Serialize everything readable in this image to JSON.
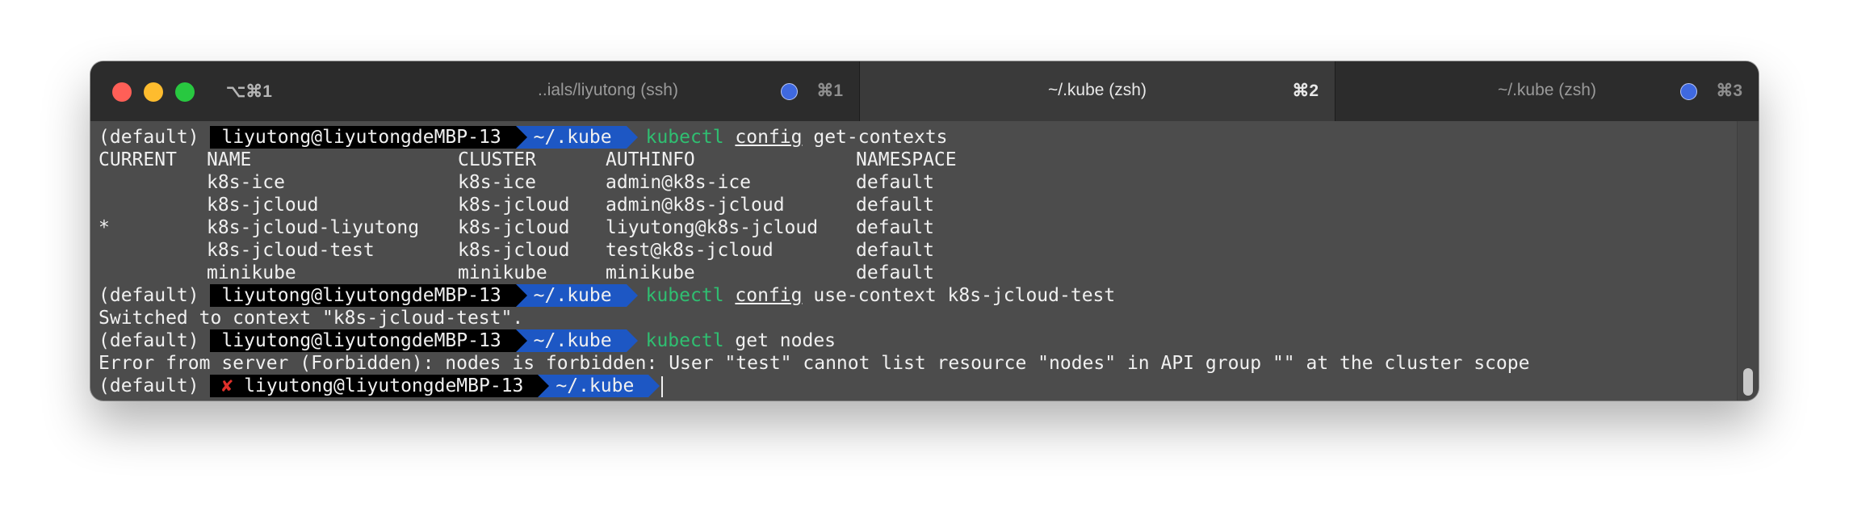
{
  "window": {
    "shortcut": "⌥⌘1",
    "tabs": [
      {
        "title": "..ials/liyutong (ssh)",
        "key": "⌘1",
        "active": false,
        "has_dot": true
      },
      {
        "title": "~/.kube (zsh)",
        "key": "⌘2",
        "active": true,
        "has_dot": false
      },
      {
        "title": "~/.kube (zsh)",
        "key": "⌘3",
        "active": false,
        "has_dot": true
      }
    ]
  },
  "prompt": {
    "env": "(default)",
    "user_host": "liyutong@liyutongdeMBP-13",
    "dir": "~/.kube",
    "error_mark": "✘"
  },
  "commands": [
    {
      "bin": "kubectl",
      "sub": "config",
      "args": "get-contexts"
    },
    {
      "bin": "kubectl",
      "sub": "config",
      "args": "use-context k8s-jcloud-test"
    },
    {
      "bin": "kubectl",
      "sub": "",
      "args": "get nodes"
    }
  ],
  "contexts_table": {
    "headers": [
      "CURRENT",
      "NAME",
      "CLUSTER",
      "AUTHINFO",
      "NAMESPACE"
    ],
    "rows": [
      [
        "",
        "k8s-ice",
        "k8s-ice",
        "admin@k8s-ice",
        "default"
      ],
      [
        "",
        "k8s-jcloud",
        "k8s-jcloud",
        "admin@k8s-jcloud",
        "default"
      ],
      [
        "*",
        "k8s-jcloud-liyutong",
        "k8s-jcloud",
        "liyutong@k8s-jcloud",
        "default"
      ],
      [
        "",
        "k8s-jcloud-test",
        "k8s-jcloud",
        "test@k8s-jcloud",
        "default"
      ],
      [
        "",
        "minikube",
        "minikube",
        "minikube",
        "default"
      ]
    ]
  },
  "outputs": {
    "switched": "Switched to context \"k8s-jcloud-test\".",
    "error": "Error from server (Forbidden): nodes is forbidden: User \"test\" cannot list resource \"nodes\" in API group \"\" at the cluster scope"
  },
  "colors": {
    "terminal_bg": "#4c4c4c",
    "titlebar_bg": "#2c2c2c",
    "prompt_user_bg": "#000000",
    "prompt_dir_bg": "#1d57c4",
    "command_green": "#2fbf71",
    "error_red": "#e0302a"
  }
}
